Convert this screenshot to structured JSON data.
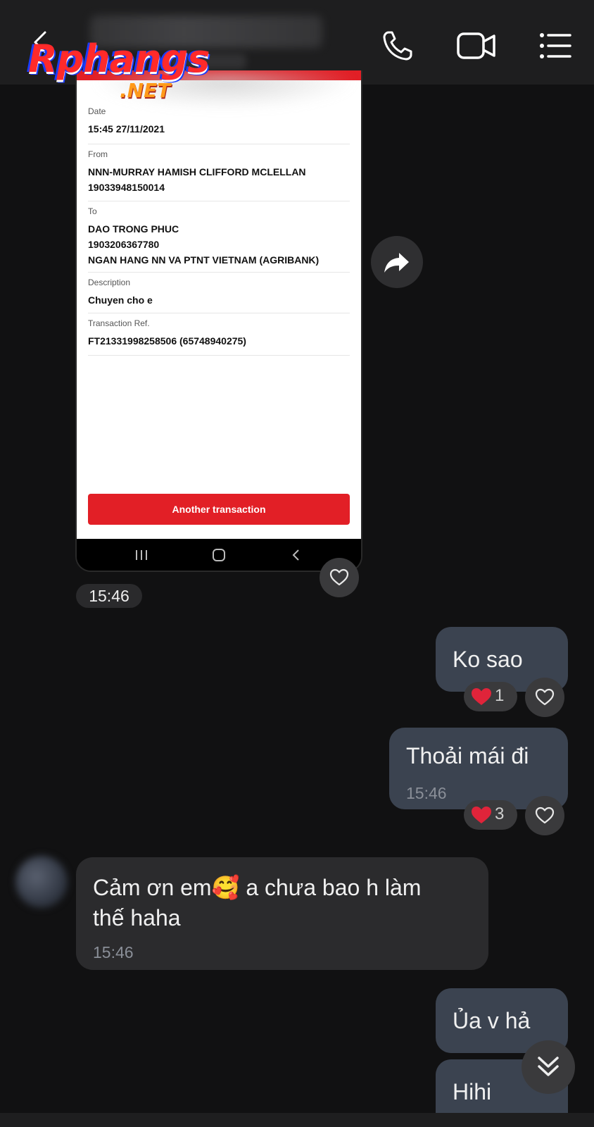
{
  "header": {
    "back_icon": "back-arrow-icon",
    "call_icon": "phone-icon",
    "video_icon": "video-call-icon",
    "menu_icon": "list-menu-icon"
  },
  "watermark": {
    "main": "Rphangs",
    "sub": ".NET"
  },
  "receipt": {
    "fields": [
      {
        "label": "Date",
        "lines": [
          "15:45 27/11/2021"
        ]
      },
      {
        "label": "From",
        "lines": [
          "NNN-MURRAY HAMISH CLIFFORD MCLELLAN",
          "19033948150014"
        ]
      },
      {
        "label": "To",
        "lines": [
          "DAO TRONG PHUC",
          "1903206367780",
          "NGAN HANG NN VA PTNT VIETNAM (AGRIBANK)"
        ]
      },
      {
        "label": "Description",
        "lines": [
          "Chuyen cho e"
        ]
      },
      {
        "label": "Transaction Ref.",
        "lines": [
          "FT21331998258506 (65748940275)"
        ]
      }
    ],
    "button_label": "Another transaction",
    "accent_color": "#e21f26"
  },
  "image_message": {
    "time": "15:46"
  },
  "messages": [
    {
      "direction": "outgoing",
      "text": "Ko sao",
      "reaction": {
        "emoji": "heart",
        "count": "1"
      }
    },
    {
      "direction": "outgoing",
      "text": "Thoải mái đi",
      "time": "15:46",
      "reaction": {
        "emoji": "heart",
        "count": "3"
      }
    },
    {
      "direction": "incoming",
      "text_before_emoji": "Cảm ơn em",
      "emoji": "🥰",
      "text_after_emoji": " a chưa bao h làm",
      "text_line2": "thế haha",
      "time": "15:46"
    },
    {
      "direction": "outgoing",
      "text": "Ủa v hả"
    },
    {
      "direction": "outgoing",
      "text": "Hihi"
    }
  ],
  "colors": {
    "background": "#111112",
    "header": "#1e1e1f",
    "outgoing_bubble": "#3b4350",
    "incoming_bubble": "#2b2b2d",
    "reaction_heart": "#e0243a"
  }
}
